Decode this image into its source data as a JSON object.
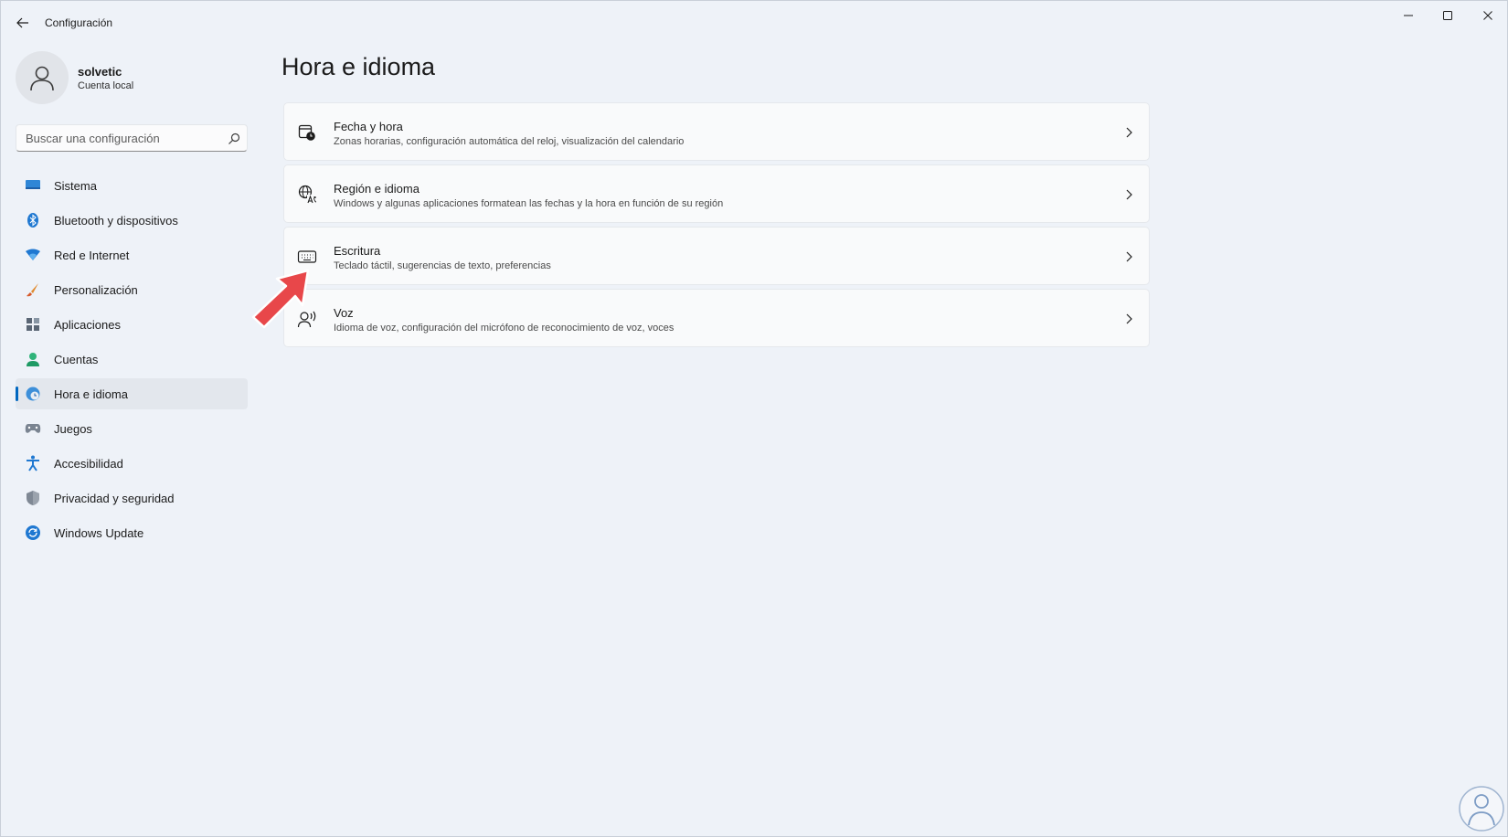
{
  "window": {
    "title": "Configuración"
  },
  "profile": {
    "name": "solvetic",
    "account": "Cuenta local"
  },
  "search": {
    "placeholder": "Buscar una configuración"
  },
  "sidebar": {
    "items": [
      {
        "label": "Sistema",
        "icon": "monitor-icon",
        "active": false
      },
      {
        "label": "Bluetooth y dispositivos",
        "icon": "bluetooth-icon",
        "active": false
      },
      {
        "label": "Red e Internet",
        "icon": "wifi-icon",
        "active": false
      },
      {
        "label": "Personalización",
        "icon": "brush-icon",
        "active": false
      },
      {
        "label": "Aplicaciones",
        "icon": "apps-icon",
        "active": false
      },
      {
        "label": "Cuentas",
        "icon": "person-icon",
        "active": false
      },
      {
        "label": "Hora e idioma",
        "icon": "globe-clock-icon",
        "active": true
      },
      {
        "label": "Juegos",
        "icon": "gamepad-icon",
        "active": false
      },
      {
        "label": "Accesibilidad",
        "icon": "accessibility-icon",
        "active": false
      },
      {
        "label": "Privacidad y seguridad",
        "icon": "shield-icon",
        "active": false
      },
      {
        "label": "Windows Update",
        "icon": "update-icon",
        "active": false
      }
    ]
  },
  "main": {
    "title": "Hora e idioma",
    "cards": [
      {
        "title": "Fecha y hora",
        "description": "Zonas horarias, configuración automática del reloj, visualización del calendario",
        "icon": "calendar-clock-icon"
      },
      {
        "title": "Región e idioma",
        "description": "Windows y algunas aplicaciones formatean las fechas y la hora en función de su región",
        "icon": "language-icon"
      },
      {
        "title": "Escritura",
        "description": "Teclado táctil, sugerencias de texto, preferencias",
        "icon": "keyboard-icon"
      },
      {
        "title": "Voz",
        "description": "Idioma de voz, configuración del micrófono de reconocimiento de voz, voces",
        "icon": "speech-icon"
      }
    ]
  },
  "colors": {
    "accent": "#0067c0",
    "arrow": "#e8474a",
    "background": "#eef2f8"
  }
}
